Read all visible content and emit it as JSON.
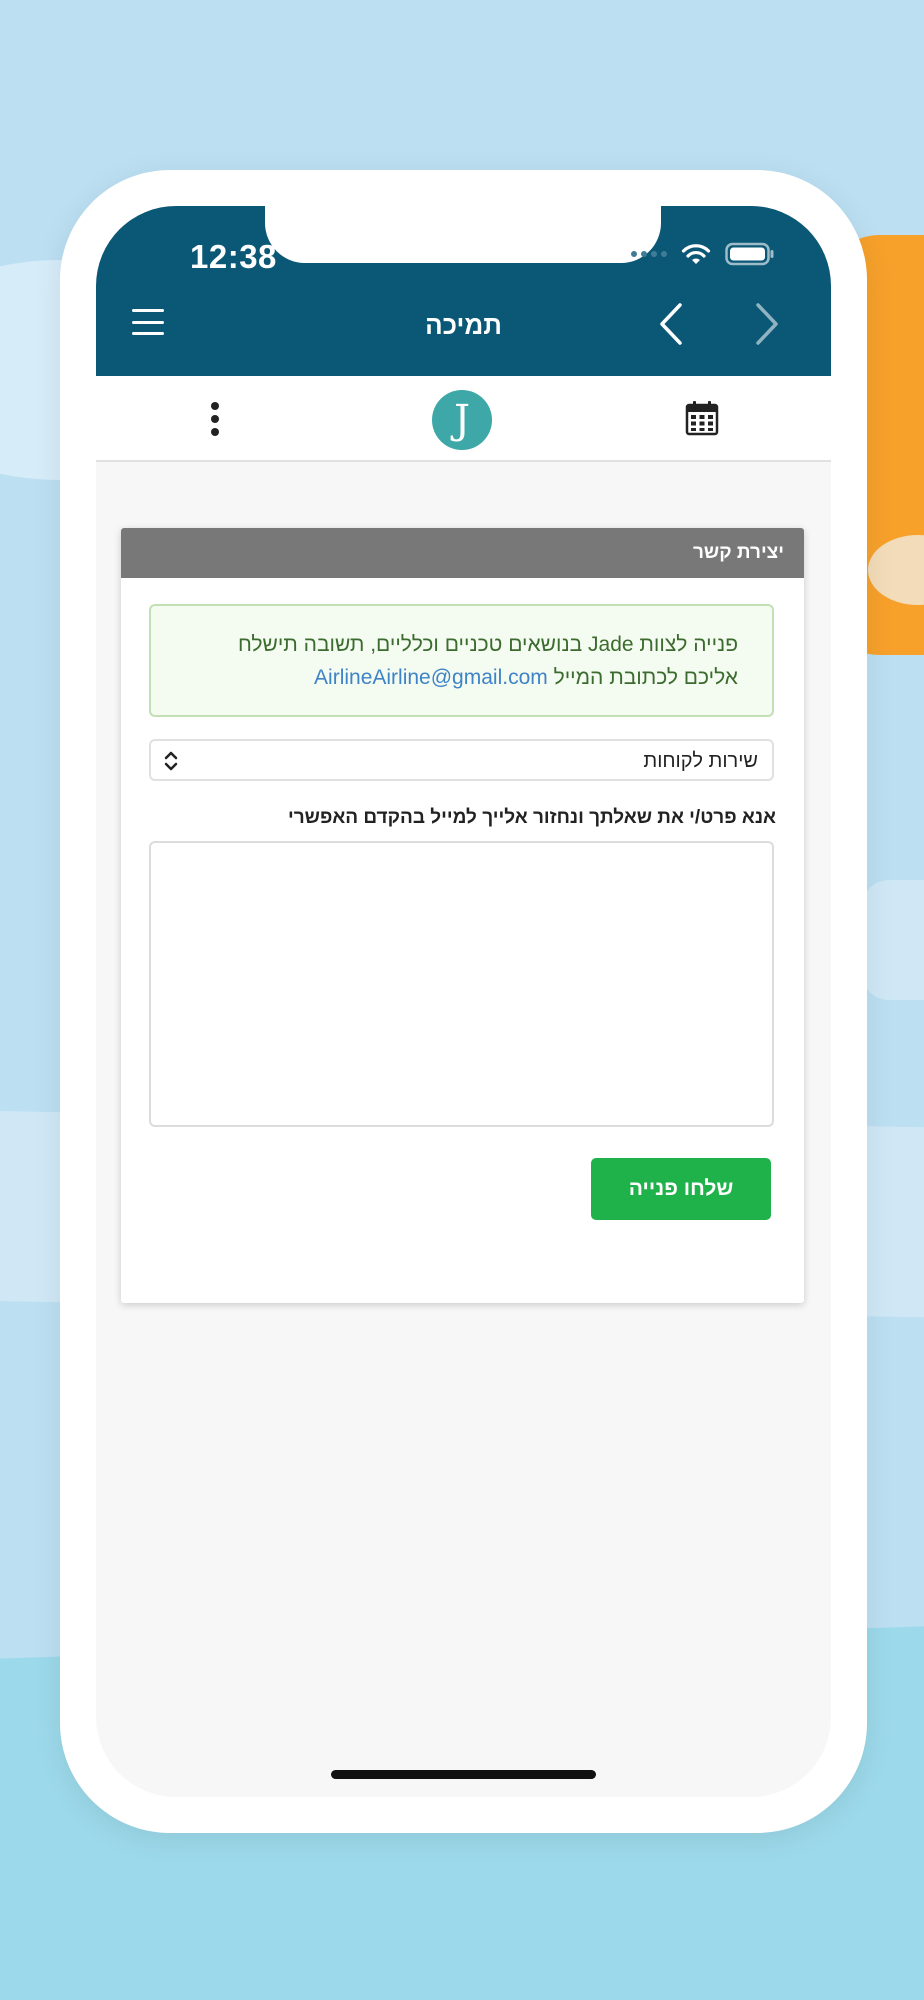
{
  "status_bar": {
    "time": "12:38"
  },
  "nav": {
    "title": "תמיכה"
  },
  "toolbar": {
    "logo_letter": "J"
  },
  "card": {
    "header": "יצירת קשר",
    "alert": {
      "line1": "פנייה לצוות Jade בנושאים טכניים וכלליים, תשובה תישלח",
      "line2_prefix": "אליכם לכתובת המייל",
      "email": "AirlineAirline@gmail.com"
    },
    "select": {
      "value": "שירות לקוחות"
    },
    "message_label": "אנא פרט/י את שאלתך ונחזור אלייך למייל בהקדם האפשרי",
    "message_value": "",
    "submit_label": "שלחו פנייה"
  },
  "colors": {
    "header_bg": "#0a5776",
    "submit_bg": "#1fb24a",
    "card_header_bg": "#787878",
    "logo_bg": "#3ea8a8"
  }
}
